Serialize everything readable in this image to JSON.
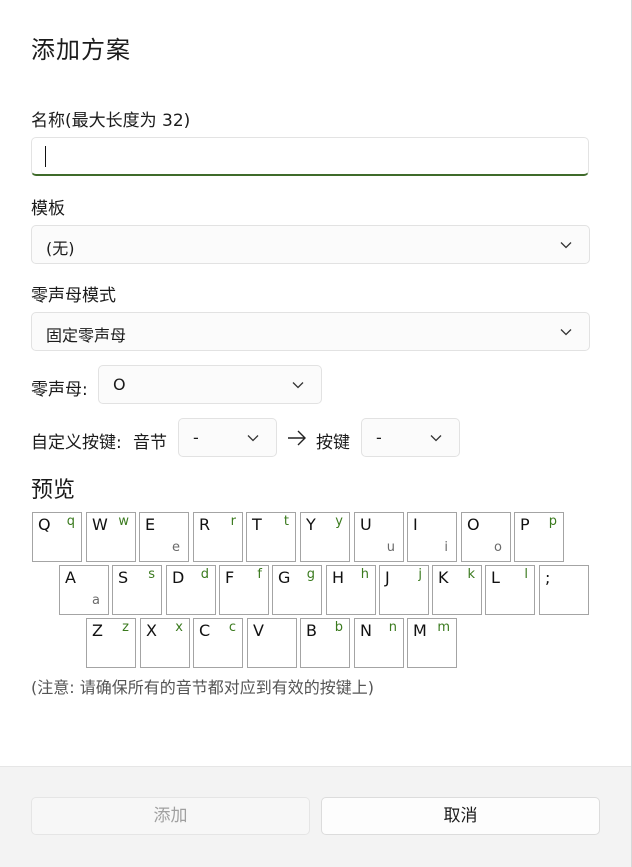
{
  "dialog": {
    "title": "添加方案",
    "name_label": "名称(最大长度为 32)",
    "name_value": "",
    "template_label": "模板",
    "template_value": "(无)",
    "zero_mode_label": "零声母模式",
    "zero_mode_value": "固定零声母",
    "zero_initial_label": "零声母:",
    "zero_initial_value": "O",
    "custom_key_label": "自定义按键:",
    "syllable_label": "音节",
    "syllable_value": "-",
    "key_label": "按键",
    "key_value": "-",
    "preview_title": "预览",
    "note": "(注意: 请确保所有的音节都对应到有效的按键上)",
    "add_button": "添加",
    "cancel_button": "取消"
  },
  "keyboard": {
    "row1": [
      {
        "main": "Q",
        "tr": "q",
        "br": ""
      },
      {
        "main": "W",
        "tr": "w",
        "br": ""
      },
      {
        "main": "E",
        "tr": "",
        "br": "e"
      },
      {
        "main": "R",
        "tr": "r",
        "br": ""
      },
      {
        "main": "T",
        "tr": "t",
        "br": ""
      },
      {
        "main": "Y",
        "tr": "y",
        "br": ""
      },
      {
        "main": "U",
        "tr": "",
        "br": "u"
      },
      {
        "main": "I",
        "tr": "",
        "br": "i"
      },
      {
        "main": "O",
        "tr": "",
        "br": "o"
      },
      {
        "main": "P",
        "tr": "p",
        "br": ""
      }
    ],
    "row2": [
      {
        "main": "A",
        "tr": "",
        "br": "a"
      },
      {
        "main": "S",
        "tr": "s",
        "br": ""
      },
      {
        "main": "D",
        "tr": "d",
        "br": ""
      },
      {
        "main": "F",
        "tr": "f",
        "br": ""
      },
      {
        "main": "G",
        "tr": "g",
        "br": ""
      },
      {
        "main": "H",
        "tr": "h",
        "br": ""
      },
      {
        "main": "J",
        "tr": "j",
        "br": ""
      },
      {
        "main": "K",
        "tr": "k",
        "br": ""
      },
      {
        "main": "L",
        "tr": "l",
        "br": ""
      },
      {
        "main": ";",
        "tr": "",
        "br": ""
      }
    ],
    "row3": [
      {
        "main": "Z",
        "tr": "z",
        "br": ""
      },
      {
        "main": "X",
        "tr": "x",
        "br": ""
      },
      {
        "main": "C",
        "tr": "c",
        "br": ""
      },
      {
        "main": "V",
        "tr": "",
        "br": ""
      },
      {
        "main": "B",
        "tr": "b",
        "br": ""
      },
      {
        "main": "N",
        "tr": "n",
        "br": ""
      },
      {
        "main": "M",
        "tr": "m",
        "br": ""
      }
    ]
  },
  "colors": {
    "accent": "#3f6b2a",
    "secondary_letter": "#3a7a1e"
  }
}
